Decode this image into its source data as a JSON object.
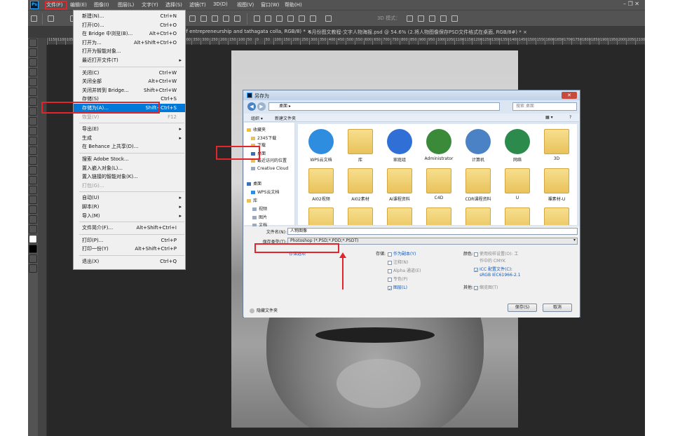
{
  "app": {
    "logo": "Ps"
  },
  "menubar": {
    "items": [
      "文件(F)",
      "编辑(E)",
      "图像(I)",
      "图层(L)",
      "文字(Y)",
      "选择(S)",
      "滤镜(T)",
      "3D(D)",
      "视图(V)",
      "窗口(W)",
      "帮助(H)"
    ],
    "window_controls": "–  ❐  ✕"
  },
  "optbar": {
    "label_3d": "3D 模式："
  },
  "tabs": [
    "did not half entrepreneurship and tathagata colla, RGB/8) *  ×",
    "6月份图文教程-文字人物海报.psd @ 54.6% (2.将人物图像保存PSD文件格式在桌面, RGB/8#) *  ×"
  ],
  "ruler": [
    "1150",
    "1100",
    "1050",
    "1000",
    "950",
    "900",
    "850",
    "800",
    "750",
    "700",
    "650",
    "600",
    "550",
    "500",
    "450",
    "400",
    "350",
    "300",
    "250",
    "200",
    "150",
    "100",
    "50",
    "0",
    "50",
    "100",
    "150",
    "200",
    "250",
    "300",
    "350",
    "400",
    "450",
    "500",
    "550",
    "600",
    "650",
    "700",
    "750",
    "800",
    "850",
    "900",
    "950",
    "1000",
    "1050",
    "1100",
    "1150",
    "1200",
    "1250",
    "1300",
    "1350",
    "1400",
    "1450",
    "1500",
    "1550",
    "1600",
    "1650",
    "1700",
    "1750",
    "1800",
    "1850",
    "1900",
    "1950",
    "2000",
    "2050",
    "2100"
  ],
  "file_menu": [
    {
      "label": "新建(N)...",
      "shortcut": "Ctrl+N"
    },
    {
      "label": "打开(O)...",
      "shortcut": "Ctrl+O"
    },
    {
      "label": "在 Bridge 中浏览(B)...",
      "shortcut": "Alt+Ctrl+O"
    },
    {
      "label": "打开为...",
      "shortcut": "Alt+Shift+Ctrl+O"
    },
    {
      "label": "打开为智能对象...",
      "shortcut": ""
    },
    {
      "label": "最近打开文件(T)",
      "shortcut": "",
      "submenu": true
    },
    {
      "sep": true
    },
    {
      "label": "关闭(C)",
      "shortcut": "Ctrl+W"
    },
    {
      "label": "关闭全部",
      "shortcut": "Alt+Ctrl+W"
    },
    {
      "label": "关闭并转到 Bridge...",
      "shortcut": "Shift+Ctrl+W"
    },
    {
      "label": "存储(S)",
      "shortcut": "Ctrl+S"
    },
    {
      "label": "存储为(A)...",
      "shortcut": "Shift+Ctrl+S",
      "highlight": true
    },
    {
      "label": "恢复(V)",
      "shortcut": "F12",
      "disabled": true
    },
    {
      "sep": true
    },
    {
      "label": "导出(E)",
      "shortcut": "",
      "submenu": true
    },
    {
      "label": "生成",
      "shortcut": "",
      "submenu": true
    },
    {
      "label": "在 Behance 上共享(D)...",
      "shortcut": ""
    },
    {
      "sep": true
    },
    {
      "label": "搜索 Adobe Stock...",
      "shortcut": ""
    },
    {
      "label": "置入嵌入对象(L)...",
      "shortcut": ""
    },
    {
      "label": "置入链接的智能对象(K)...",
      "shortcut": ""
    },
    {
      "label": "打包(G)...",
      "shortcut": "",
      "disabled": true
    },
    {
      "sep": true
    },
    {
      "label": "自动(U)",
      "shortcut": "",
      "submenu": true
    },
    {
      "label": "脚本(R)",
      "shortcut": "",
      "submenu": true
    },
    {
      "label": "导入(M)",
      "shortcut": "",
      "submenu": true
    },
    {
      "sep": true
    },
    {
      "label": "文件简介(F)...",
      "shortcut": "Alt+Shift+Ctrl+I"
    },
    {
      "sep": true
    },
    {
      "label": "打印(P)...",
      "shortcut": "Ctrl+P"
    },
    {
      "label": "打印一份(Y)",
      "shortcut": "Alt+Shift+Ctrl+P"
    },
    {
      "sep": true
    },
    {
      "label": "退出(X)",
      "shortcut": "Ctrl+Q"
    }
  ],
  "dialog": {
    "title": "另存为",
    "close": "✕",
    "address": "桌面 ▸",
    "search_placeholder": "搜索 桌面",
    "cmd_organize": "组织 ▾",
    "cmd_new_folder": "新建文件夹",
    "nav": [
      {
        "label": "收藏夹",
        "kind": "star"
      },
      {
        "label": "2345下载",
        "kind": "folder"
      },
      {
        "label": "下载",
        "kind": "folder"
      },
      {
        "label": "桌面",
        "kind": "desk"
      },
      {
        "label": "最近访问的位置",
        "kind": "folder"
      },
      {
        "label": "Creative Cloud",
        "kind": "file"
      },
      {
        "label": "桌面",
        "kind": "desk"
      },
      {
        "label": "WPS云文档",
        "kind": "cloud"
      },
      {
        "label": "库",
        "kind": "folder"
      },
      {
        "label": "视频",
        "kind": "file"
      },
      {
        "label": "图片",
        "kind": "file"
      },
      {
        "label": "文档",
        "kind": "file"
      }
    ],
    "files": [
      {
        "name": "WPS云文档",
        "kind": "cloud"
      },
      {
        "name": "库",
        "kind": "lib"
      },
      {
        "name": "家庭组",
        "kind": "home"
      },
      {
        "name": "Administrator",
        "kind": "user"
      },
      {
        "name": "计算机",
        "kind": "pc"
      },
      {
        "name": "网络",
        "kind": "net"
      },
      {
        "name": "3D",
        "kind": "folder"
      },
      {
        "name": "AI02视频",
        "kind": "folder"
      },
      {
        "name": "AI02素材",
        "kind": "folder"
      },
      {
        "name": "AI课程资料",
        "kind": "folder"
      },
      {
        "name": "C4D",
        "kind": "folder"
      },
      {
        "name": "CDR课程资料",
        "kind": "folder"
      },
      {
        "name": "U",
        "kind": "folder"
      },
      {
        "name": "裸素材-U",
        "kind": "folder"
      },
      {
        "name": "",
        "kind": "folder"
      },
      {
        "name": "",
        "kind": "folder"
      },
      {
        "name": "",
        "kind": "folder"
      },
      {
        "name": "",
        "kind": "folder"
      },
      {
        "name": "",
        "kind": "folder"
      },
      {
        "name": "",
        "kind": "folder"
      },
      {
        "name": "",
        "kind": "folder"
      }
    ],
    "filename_label": "文件名(N):",
    "filename_value": "人物图像",
    "savetype_label": "保存类型(T):",
    "savetype_value": "Photoshop (*.PSD;*.PDD;*.PSDT)",
    "storage_options": "存储选项",
    "save_label": "存储:",
    "opt_copy": "作为副本(Y)",
    "opt_notes": "注释(N)",
    "opt_alpha": "Alpha 通道(E)",
    "opt_spot": "专色(P)",
    "opt_layers": "图层(L)",
    "color_label": "颜色:",
    "opt_proof": "使用校样设置(O): 工",
    "opt_proof2": "作中的 CMYK",
    "opt_icc": "ICC 配置文件(C):",
    "opt_icc2": "sRGB IEC61966-2.1",
    "other_label": "其他:",
    "opt_thumb": "缩览图(T)",
    "hide_folders": "隐藏文件夹",
    "save_btn": "保存(S)",
    "cancel_btn": "取消"
  }
}
